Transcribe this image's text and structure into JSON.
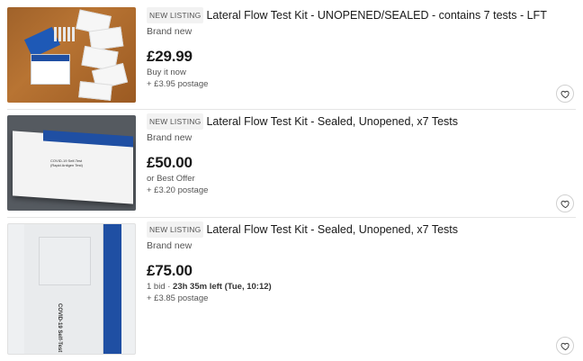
{
  "listings": [
    {
      "badge": "NEW LISTING",
      "title": "Lateral Flow Test Kit - UNOPENED/SEALED - contains 7 tests - LFT",
      "condition": "Brand new",
      "price": "£29.99",
      "purchase_type": "Buy it now",
      "postage": "+ £3.95 postage"
    },
    {
      "badge": "NEW LISTING",
      "title": "Lateral Flow Test Kit - Sealed, Unopened, x7 Tests",
      "condition": "Brand new",
      "price": "£50.00",
      "purchase_type": "or Best Offer",
      "postage": "+ £3.20 postage"
    },
    {
      "badge": "NEW LISTING",
      "title": "Lateral Flow Test Kit - Sealed, Unopened, x7 Tests",
      "condition": "Brand new",
      "price": "£75.00",
      "bids": "1 bid · ",
      "time_left": "23h 35m left (Tue, 10:12)",
      "postage": "+ £3.85 postage"
    }
  ],
  "image_text": {
    "box_line1": "COVID-19 Self-Test",
    "box_line2": "(Rapid Antigen Test)"
  },
  "icons": {
    "watch": "heart-icon"
  },
  "colors": {
    "nhs_blue": "#1f4fa3",
    "text": "#191919",
    "muted": "#555555"
  }
}
